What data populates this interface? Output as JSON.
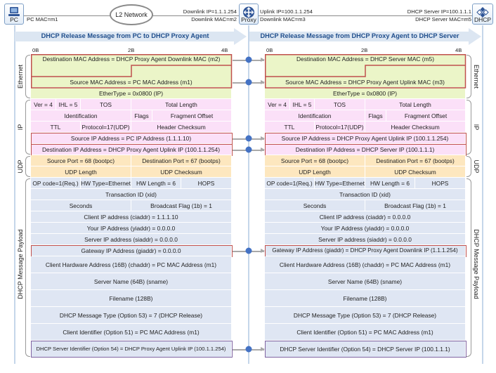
{
  "nodes": {
    "pc": {
      "label": "PC",
      "icon": "laptop-icon"
    },
    "proxy": {
      "label": "Proxy",
      "icon": "router-icon"
    },
    "dhcp": {
      "label": "DHCP",
      "icon": "dhcp-server-icon"
    },
    "network": {
      "label": "L2 Network"
    }
  },
  "links": {
    "pc_mac": "PC MAC=m1",
    "downlink_ip": "Downlink IP=1.1.1.254",
    "downlink_mac_m2": "Downlink MAC=m2",
    "uplink_ip": "Uplink IP=100.1.1.254",
    "downlink_mac_m3": "Downlink MAC=m3",
    "server_ip": "DHCP Server IP=100.1.1.1",
    "server_mac": "DHCP Server MAC=m5"
  },
  "colors": {
    "ethernet": "#ebf5c8",
    "ip": "#fbe0f8",
    "udp": "#fde7bf",
    "dhcp": "#dfe6f3",
    "highlight_red": "#c0504d",
    "highlight_purple": "#8064a2",
    "accent": "#4472c4",
    "banner_text": "#1f4e8c"
  },
  "ticks": [
    "0B",
    "2B",
    "4B"
  ],
  "layer_labels": {
    "ethernet": "Ethernet",
    "ip": "IP",
    "udp": "UDP",
    "dhcp": "DHCP Message Payload"
  },
  "left": {
    "banner": "DHCP Release Message from PC to DHCP Proxy Agent",
    "eth": {
      "dst": "Destination MAC Address = DHCP Proxy Agent Downlink MAC (m2)",
      "src": "Source MAC Address = PC MAC Address (m1)",
      "type": "EtherType = 0x0800 (IP)"
    },
    "ip": {
      "ver": "Ver = 4",
      "ihl": "IHL = 5",
      "tos": "TOS",
      "total_length": "Total Length",
      "identification": "Identification",
      "flags": "Flags",
      "frag_offset": "Fragment Offset",
      "ttl": "TTL",
      "protocol": "Protocol=17(UDP)",
      "checksum": "Header Checksum",
      "src": "Source IP Address = PC IP Address (1.1.1.10)",
      "dst": "Destination IP Address = DHCP Proxy Agent Uplink IP (100.1.1.254)"
    },
    "udp": {
      "src_port": "Source Port = 68 (bootpc)",
      "dst_port": "Destination Port = 67 (bootps)",
      "length": "UDP Length",
      "checksum": "UDP Checksum"
    },
    "dhcp": {
      "op": "OP code=1(Req.)",
      "htype": "HW Type=Ethernet",
      "hlen": "HW Length = 6",
      "hops": "HOPS",
      "xid": "Transaction ID (xid)",
      "secs": "Seconds",
      "flags": "Broadcast Flag (1b) = 1",
      "ciaddr": "Client IP address (ciaddr) = 1.1.1.10",
      "yiaddr": "Your IP Address (yiaddr) = 0.0.0.0",
      "siaddr": "Server IP address (siaddr) = 0.0.0.0",
      "giaddr": "Gateway IP Address (giaddr) = 0.0.0.0",
      "chaddr": "Client Hardware Address (16B) (chaddr) = PC MAC Address (m1)",
      "sname": "Server Name (64B) (sname)",
      "file": "Filename (128B)",
      "opt53": "DHCP Message Type (Option 53) = 7 (DHCP Release)",
      "opt51": "Client Identifier (Option 51) = PC MAC Address (m1)",
      "opt54": "DHCP Server Identifier (Option 54) = DHCP Proxy Agent Uplink IP (100.1.1.254)"
    }
  },
  "right": {
    "banner": "DHCP Release Message from DHCP Proxy Agent to DHCP Server",
    "eth": {
      "dst": "Destination MAC Address = DHCP Server MAC (m5)",
      "src": "Source MAC Address = DHCP Proxy Agent Uplink MAC (m3)",
      "type": "EtherType = 0x0800 (IP)"
    },
    "ip": {
      "ver": "Ver = 4",
      "ihl": "IHL = 5",
      "tos": "TOS",
      "total_length": "Total Length",
      "identification": "Identification",
      "flags": "Flags",
      "frag_offset": "Fragment Offset",
      "ttl": "TTL",
      "protocol": "Protocol=17(UDP)",
      "checksum": "Header Checksum",
      "src": "Source IP Address = DHCP Proxy Agent Uplink IP (100.1.1.254)",
      "dst": "Destination IP Address = DHCP Server IP (100.1.1.1)"
    },
    "udp": {
      "src_port": "Source Port = 68 (bootpc)",
      "dst_port": "Destination Port = 67 (bootps)",
      "length": "UDP Length",
      "checksum": "UDP Checksum"
    },
    "dhcp": {
      "op": "OP code=1(Req.)",
      "htype": "HW Type=Ethernet",
      "hlen": "HW Length = 6",
      "hops": "HOPS",
      "xid": "Transaction ID (xid)",
      "secs": "Seconds",
      "flags": "Broadcast Flag (1b) = 1",
      "ciaddr": "Client IP address (ciaddr) = 0.0.0.0",
      "yiaddr": "Your IP Address (yiaddr) = 0.0.0.0",
      "siaddr": "Server IP address (siaddr) = 0.0.0.0",
      "giaddr": "Gateway IP Address (giaddr) = DHCP Proxy Agent Downlink IP (1.1.1.254)",
      "chaddr": "Client Hardware Address (16B) (chaddr) = PC MAC Address (m1)",
      "sname": "Server Name (64B) (sname)",
      "file": "Filename (128B)",
      "opt53": "DHCP Message Type (Option 53) = 7 (DHCP Release)",
      "opt51": "Client Identifier (Option 51) = PC MAC Address (m1)",
      "opt54": "DHCP Server Identifier (Option 54) = DHCP Server IP (100.1.1.1)"
    }
  }
}
